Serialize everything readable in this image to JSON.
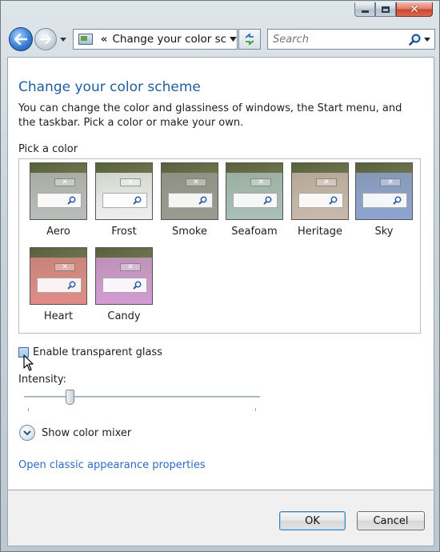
{
  "navigation": {
    "address_sep": "«",
    "address_text": "Change your color scl",
    "search_placeholder": "Search"
  },
  "page": {
    "title": "Change your color scheme",
    "description": "You can change the color and glassiness of windows, the Start menu, and the taskbar. Pick a color or make your own.",
    "pick_label": "Pick a color"
  },
  "colors": [
    {
      "name": "Aero",
      "tint": "#b8bdbb"
    },
    {
      "name": "Frost",
      "tint": "#eef0f0"
    },
    {
      "name": "Smoke",
      "tint": "#9a9a92"
    },
    {
      "name": "Seafoam",
      "tint": "#a9bfb8"
    },
    {
      "name": "Heritage",
      "tint": "#c9b8ac"
    },
    {
      "name": "Sky",
      "tint": "#8ea3d3"
    },
    {
      "name": "Heart",
      "tint": "#e08a86"
    },
    {
      "name": "Candy",
      "tint": "#d39bd3"
    }
  ],
  "options": {
    "transparency_label": "Enable transparent glass",
    "transparency_checked": false,
    "intensity_label": "Intensity:",
    "intensity_value": 0.18,
    "mixer_label": "Show color mixer",
    "classic_link": "Open classic appearance properties"
  },
  "buttons": {
    "ok": "OK",
    "cancel": "Cancel"
  },
  "icons": {
    "back": "back-arrow-icon",
    "forward": "forward-arrow-icon",
    "refresh": "refresh-icon",
    "search": "magnifier-icon"
  }
}
